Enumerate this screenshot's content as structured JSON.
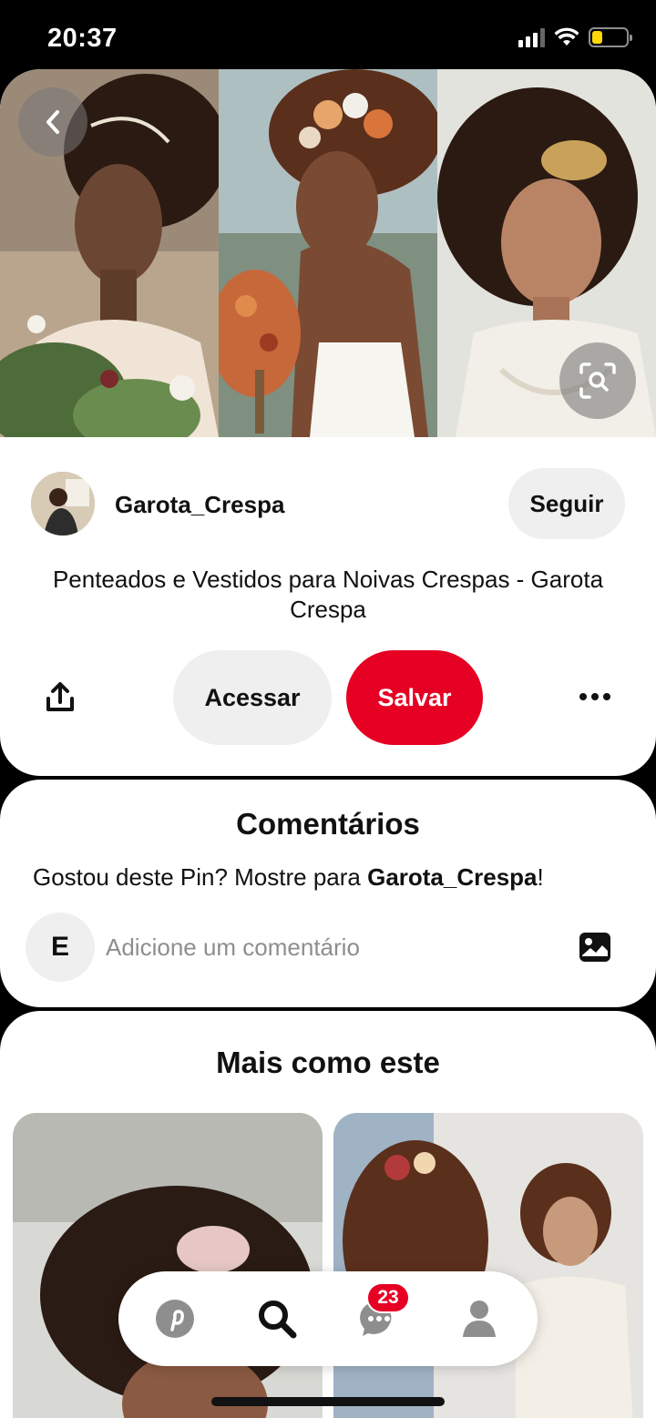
{
  "status_bar": {
    "time": "20:37",
    "icons": [
      "signal-icon",
      "wifi-icon",
      "battery-icon"
    ],
    "battery_color": "#ffd60a"
  },
  "pin": {
    "images": [
      {
        "name": "bride-photo-1",
        "palette": [
          "#a88f76",
          "#3a2418",
          "#6b8c4f"
        ]
      },
      {
        "name": "bride-photo-2",
        "palette": [
          "#9fb5b8",
          "#3b2418",
          "#d98b4a"
        ]
      },
      {
        "name": "bride-photo-3",
        "palette": [
          "#d7d7d2",
          "#2a1a12",
          "#f2efe8"
        ]
      }
    ],
    "author": {
      "name": "Garota_Crespa",
      "follow_label": "Seguir"
    },
    "title": "Penteados e Vestidos para Noivas Crespas - Garota Crespa",
    "actions": {
      "visit_label": "Acessar",
      "save_label": "Salvar"
    }
  },
  "comments": {
    "title": "Comentários",
    "prompt_prefix": "Gostou deste Pin? Mostre para ",
    "prompt_author": "Garota_Crespa",
    "prompt_suffix": "!",
    "user_initial": "E",
    "placeholder": "Adicione um comentário"
  },
  "more_like_this": {
    "title": "Mais como este"
  },
  "bottom_nav": {
    "items": [
      "pinterest-home-icon",
      "search-icon",
      "messages-icon",
      "profile-icon"
    ],
    "messages_badge": "23"
  },
  "colors": {
    "brand_red": "#e60023",
    "button_gray": "#efefef"
  }
}
